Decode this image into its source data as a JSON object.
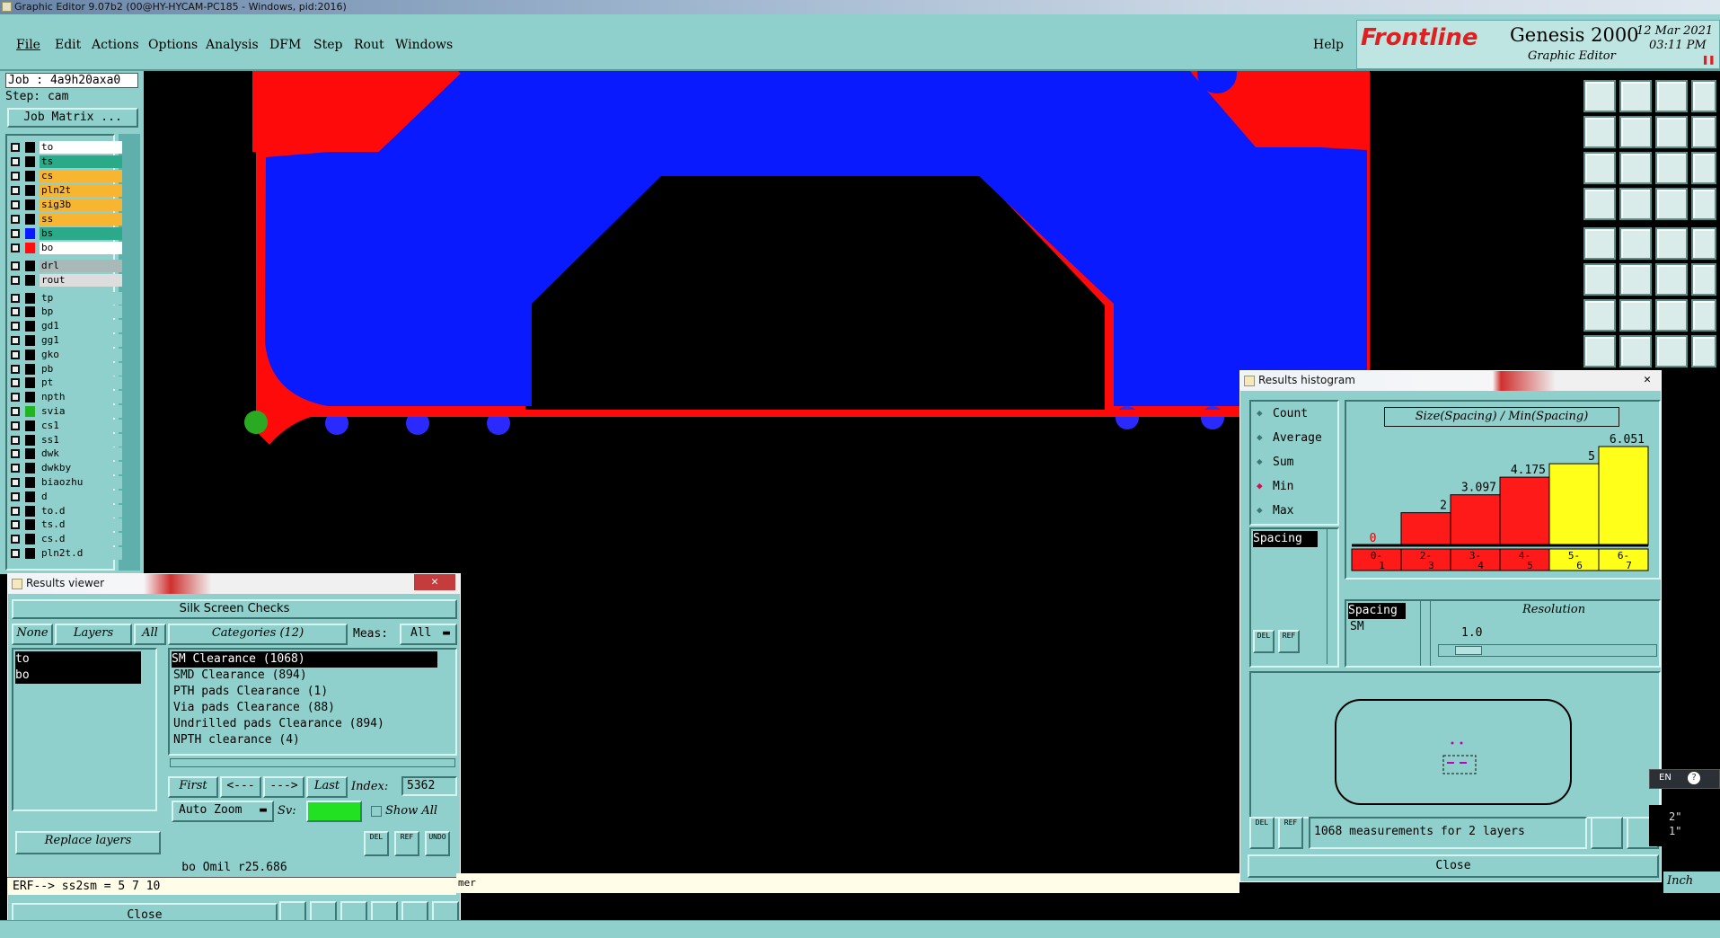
{
  "window_title": "Graphic Editor 9.07b2 (00@HY-HYCAM-PC185 - Windows, pid:2016)",
  "menu": {
    "file": "File",
    "edit": "Edit",
    "actions": "Actions",
    "options": "Options",
    "analysis": "Analysis",
    "dfm": "DFM",
    "step": "Step",
    "rout": "Rout",
    "windows": "Windows",
    "help": "Help"
  },
  "logo": {
    "brand": "Frontline",
    "product": "Genesis 2000",
    "subtitle": "Graphic Editor",
    "date": "12 Mar 2021",
    "time": "03:11 PM"
  },
  "job": {
    "job_label": "Job : 4a9h20axa0",
    "step_label": "Step: cam",
    "matrix_button": "Job Matrix ..."
  },
  "layers": [
    {
      "name": "to",
      "color": "#ffffff"
    },
    {
      "name": "ts",
      "color": "#2aaa88"
    },
    {
      "name": "cs",
      "color": "#f7b531"
    },
    {
      "name": "pln2t",
      "color": "#f7b531"
    },
    {
      "name": "sig3b",
      "color": "#f7b531"
    },
    {
      "name": "ss",
      "color": "#f7b531"
    },
    {
      "name": "bs",
      "color": "#2aaa88"
    },
    {
      "name": "bo",
      "color": "#ffffff"
    },
    {
      "name": "drl",
      "color": "#a9b9b8"
    },
    {
      "name": "rout",
      "color": "#dddddd"
    },
    {
      "name": "tp",
      "color": "#8fd0cc"
    },
    {
      "name": "bp",
      "color": "#8fd0cc"
    },
    {
      "name": "gd1",
      "color": "#8fd0cc"
    },
    {
      "name": "gg1",
      "color": "#8fd0cc"
    },
    {
      "name": "gko",
      "color": "#8fd0cc"
    },
    {
      "name": "pb",
      "color": "#8fd0cc"
    },
    {
      "name": "pt",
      "color": "#8fd0cc"
    },
    {
      "name": "npth",
      "color": "#8fd0cc"
    },
    {
      "name": "svia",
      "color": "#8fd0cc"
    },
    {
      "name": "cs1",
      "color": "#8fd0cc"
    },
    {
      "name": "ss1",
      "color": "#8fd0cc"
    },
    {
      "name": "dwk",
      "color": "#8fd0cc"
    },
    {
      "name": "dwkby",
      "color": "#8fd0cc"
    },
    {
      "name": "biaozhu",
      "color": "#8fd0cc"
    },
    {
      "name": "d",
      "color": "#8fd0cc"
    },
    {
      "name": "to.d",
      "color": "#8fd0cc"
    },
    {
      "name": "ts.d",
      "color": "#8fd0cc"
    },
    {
      "name": "cs.d",
      "color": "#8fd0cc"
    },
    {
      "name": "pln2t.d",
      "color": "#8fd0cc"
    }
  ],
  "results_viewer": {
    "title": "Results viewer",
    "header": "Silk Screen Checks",
    "none_btn": "None",
    "layers_btn": "Layers",
    "all_btn": "All",
    "categories_label": "Categories (12)",
    "meas_label": "Meas:",
    "meas_value": "All",
    "layers_list": [
      "to",
      "bo"
    ],
    "categories": [
      "SM Clearance (1068)",
      "SMD Clearance (894)",
      "PTH pads Clearance (1)",
      "Via pads Clearance (88)",
      "Undrilled pads Clearance (894)",
      "NPTH clearance (4)"
    ],
    "first_btn": "First",
    "prev_btn": "<---",
    "next_btn": "--->",
    "last_btn": "Last",
    "index_label": "Index:",
    "index_value": "5362",
    "auto_zoom": "Auto Zoom",
    "sv_label": "Sv:",
    "show_all": "Show All",
    "replace_layers": "Replace layers",
    "del": "DEL",
    "ref": "REF",
    "undo": "UNDO",
    "status": "bo Omil  r25.686",
    "close": "Close"
  },
  "command_line": "ERF--> ss2sm = 5 7 10",
  "command_line_tail": "mer",
  "histogram": {
    "title": "Results histogram",
    "stats": [
      "Count",
      "Average",
      "Sum",
      "Min",
      "Max"
    ],
    "stat_selected": "Min",
    "chart_title": "Size(Spacing) / Min(Spacing)",
    "list_item": "Spacing",
    "resolution_label": "Resolution",
    "resolution_value": "1.0",
    "sel_list": [
      "Spacing",
      "SM"
    ],
    "del": "DEL",
    "ref": "REF",
    "summary": "1068 measurements for 2 layers",
    "close": "Close"
  },
  "chart_data": {
    "type": "bar",
    "title": "Size(Spacing) / Min(Spacing)",
    "categories": [
      "0-1",
      "2-3",
      "3-4",
      "4-5",
      "5-6",
      "6-7"
    ],
    "values": [
      0,
      2,
      3.097,
      4.175,
      5,
      6.051
    ],
    "value_labels": [
      "0",
      "2",
      "3.097",
      "4.175",
      "5",
      "6.051"
    ],
    "colors": [
      "#ff1a1a",
      "#ff1a1a",
      "#ff1a1a",
      "#ff1a1a",
      "#ffff1a",
      "#ffff1a"
    ],
    "ylim": [
      0,
      6.051
    ]
  },
  "colors": {
    "panel": "#8fd0cc",
    "copper": "#0a1aff",
    "outline": "#ff0a0a",
    "selected_bar": "#ffff1a"
  },
  "bottom_right": {
    "line1": "2\"",
    "line2": "1\"",
    "unit": "Inch"
  },
  "ime": {
    "lang": "EN"
  }
}
